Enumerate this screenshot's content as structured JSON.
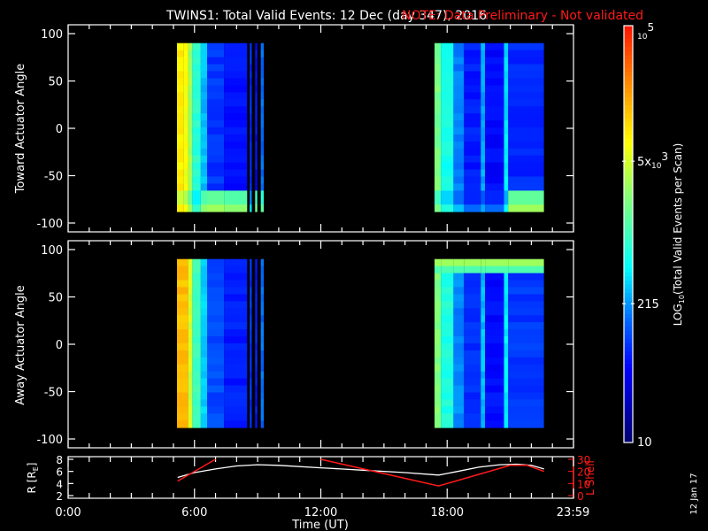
{
  "title": "TWINS1: Total Valid Events: 12 Dec (day 347), 2016",
  "note": "NOTE: Data Preliminary - Not validated",
  "side_date": "12 Jan 17",
  "colors": {
    "note": "#ff1a1a",
    "lshell": "#ff1a1a",
    "r_line": "#ffffff",
    "background": "#000000"
  },
  "chart_data": [
    {
      "type": "heatmap",
      "name": "toward",
      "ylabel": "Toward Actuator Angle",
      "ylim": [
        -100,
        100
      ],
      "yticks": [
        "100",
        "50",
        "0",
        "-50",
        "-100"
      ],
      "ytick_values": [
        100,
        50,
        0,
        -50,
        -100
      ],
      "angle_range": [
        -88,
        90
      ],
      "columns": [
        [
          5.17,
          5.5,
          9000,
          9000
        ],
        [
          5.5,
          5.7,
          7000,
          7000
        ],
        [
          5.7,
          5.9,
          3000,
          3000
        ],
        [
          5.9,
          6.3,
          800,
          900
        ],
        [
          6.3,
          6.6,
          300,
          2500
        ],
        [
          6.6,
          7.4,
          90,
          3000
        ],
        [
          7.4,
          8.5,
          60,
          2500
        ],
        [
          8.62,
          8.72,
          80,
          400
        ],
        [
          8.88,
          8.98,
          60,
          2000
        ],
        [
          9.15,
          9.29,
          150,
          1500
        ],
        [
          17.4,
          17.7,
          2000,
          2000
        ],
        [
          17.7,
          18.3,
          600,
          700
        ],
        [
          18.3,
          18.8,
          180,
          300
        ],
        [
          18.8,
          19.6,
          70,
          150
        ],
        [
          19.6,
          19.8,
          250,
          250
        ],
        [
          19.8,
          20.7,
          55,
          150
        ],
        [
          20.7,
          20.9,
          400,
          500
        ],
        [
          20.9,
          22.6,
          80,
          3000
        ]
      ]
    },
    {
      "type": "heatmap",
      "name": "away",
      "ylabel": "Away Actuator Angle",
      "ylim": [
        -100,
        100
      ],
      "yticks": [
        "100",
        "50",
        "0",
        "-50",
        "-100"
      ],
      "ytick_values": [
        100,
        50,
        0,
        -50,
        -100
      ],
      "angle_range": [
        -88,
        90
      ],
      "columns": [
        [
          5.17,
          5.7,
          16000,
          16000
        ],
        [
          5.7,
          5.9,
          5000,
          5000
        ],
        [
          5.9,
          6.3,
          1000,
          1000
        ],
        [
          6.3,
          6.6,
          350,
          350
        ],
        [
          6.6,
          7.4,
          110,
          110
        ],
        [
          7.4,
          8.5,
          70,
          70
        ],
        [
          8.62,
          8.72,
          90,
          90
        ],
        [
          8.88,
          8.98,
          70,
          70
        ],
        [
          9.15,
          9.29,
          160,
          160
        ],
        [
          17.4,
          17.7,
          2200,
          2200
        ],
        [
          17.7,
          18.3,
          700,
          700
        ],
        [
          18.3,
          18.8,
          200,
          200
        ],
        [
          18.8,
          19.6,
          80,
          80
        ],
        [
          19.6,
          19.8,
          300,
          300
        ],
        [
          19.8,
          20.7,
          60,
          60
        ],
        [
          20.7,
          20.9,
          450,
          450
        ],
        [
          20.9,
          22.6,
          90,
          90
        ]
      ],
      "top_enhance_value": 3000
    },
    {
      "type": "line",
      "name": "orbit",
      "xlabel": "Time (UT)",
      "xticks": [
        "0:00",
        "6:00",
        "12:00",
        "18:00",
        "23:59"
      ],
      "xtick_values": [
        0,
        6,
        12,
        18,
        23.98
      ],
      "xlim": [
        0,
        24
      ],
      "ylabel": "R [R_E]",
      "ylabel_main": "R [R",
      "ylabel_sub": "E",
      "ylabel_end": "]",
      "ylim": [
        2,
        8
      ],
      "yticks": [
        "8",
        "6",
        "4",
        "2"
      ],
      "ytick_values": [
        8,
        6,
        4,
        2
      ],
      "y2label": "L Shell",
      "y2lim": [
        0,
        30
      ],
      "y2ticks": [
        "30",
        "20",
        "10",
        "0"
      ],
      "y2tick_values": [
        30,
        20,
        10,
        0
      ],
      "series": [
        {
          "name": "R",
          "x": [
            5.2,
            6,
            7,
            8,
            9,
            10,
            12,
            14,
            16,
            17.6,
            18.5,
            19.5,
            20.5,
            21.3,
            22,
            22.6
          ],
          "y": [
            5.0,
            5.8,
            6.4,
            6.9,
            7.1,
            7.0,
            6.6,
            6.2,
            5.8,
            5.4,
            6.0,
            6.7,
            7.1,
            7.2,
            7.0,
            6.4
          ]
        },
        {
          "name": "L Shell",
          "x": [
            5.2,
            7.0,
            null,
            12.0,
            17.6,
            21.0,
            21.8,
            22.6
          ],
          "y": [
            12,
            30,
            null,
            30,
            8,
            25,
            25,
            20
          ]
        }
      ]
    }
  ],
  "colorbar": {
    "label": "LOG10(Total Valid Events per Scan)",
    "label_pre": "LOG",
    "label_sub": "10",
    "label_post": "(Total Valid Events per Scan)",
    "range": [
      10,
      100000
    ],
    "ticks": [
      {
        "value": 100000,
        "base": "10",
        "sup": "5",
        "prefix": ""
      },
      {
        "value": 5000,
        "base": "10",
        "sup": "3",
        "prefix": "5x"
      },
      {
        "value": 215,
        "base": "215",
        "sup": "",
        "prefix": ""
      },
      {
        "value": 10,
        "base": "10",
        "sup": "",
        "prefix": ""
      }
    ]
  }
}
